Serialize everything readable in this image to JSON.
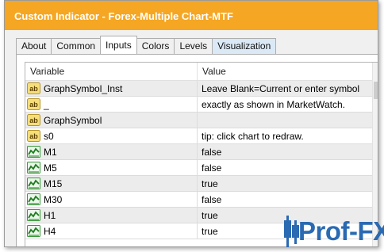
{
  "window": {
    "title": "Custom Indicator - Forex-Multiple Chart-MTF"
  },
  "tabs": [
    {
      "label": "About"
    },
    {
      "label": "Common"
    },
    {
      "label": "Inputs"
    },
    {
      "label": "Colors"
    },
    {
      "label": "Levels"
    },
    {
      "label": "Visualization"
    }
  ],
  "active_tab": "Inputs",
  "table": {
    "columns": {
      "variable": "Variable",
      "value": "Value"
    },
    "rows": [
      {
        "type": "string",
        "icon": "ab-string-icon",
        "variable": "GraphSymbol_Inst",
        "value": "Leave Blank=Current or enter symbol"
      },
      {
        "type": "string",
        "icon": "ab-string-icon",
        "variable": "_",
        "value": "exactly as shown in MarketWatch."
      },
      {
        "type": "string",
        "icon": "ab-string-icon",
        "variable": "GraphSymbol",
        "value": ""
      },
      {
        "type": "string",
        "icon": "ab-string-icon",
        "variable": "s0",
        "value": "tip: click chart to redraw."
      },
      {
        "type": "bool",
        "icon": "bool-chart-icon",
        "variable": "M1",
        "value": "false"
      },
      {
        "type": "bool",
        "icon": "bool-chart-icon",
        "variable": "M5",
        "value": "false"
      },
      {
        "type": "bool",
        "icon": "bool-chart-icon",
        "variable": "M15",
        "value": "true"
      },
      {
        "type": "bool",
        "icon": "bool-chart-icon",
        "variable": "M30",
        "value": "false"
      },
      {
        "type": "bool",
        "icon": "bool-chart-icon",
        "variable": "H1",
        "value": "true"
      },
      {
        "type": "bool",
        "icon": "bool-chart-icon",
        "variable": "H4",
        "value": "true"
      }
    ]
  },
  "logo": {
    "text": "Prof-FX"
  },
  "colors": {
    "titlebar": "#f5a623",
    "logo": "#2a6ab2",
    "tab_highlight": "#dbe9f6"
  }
}
